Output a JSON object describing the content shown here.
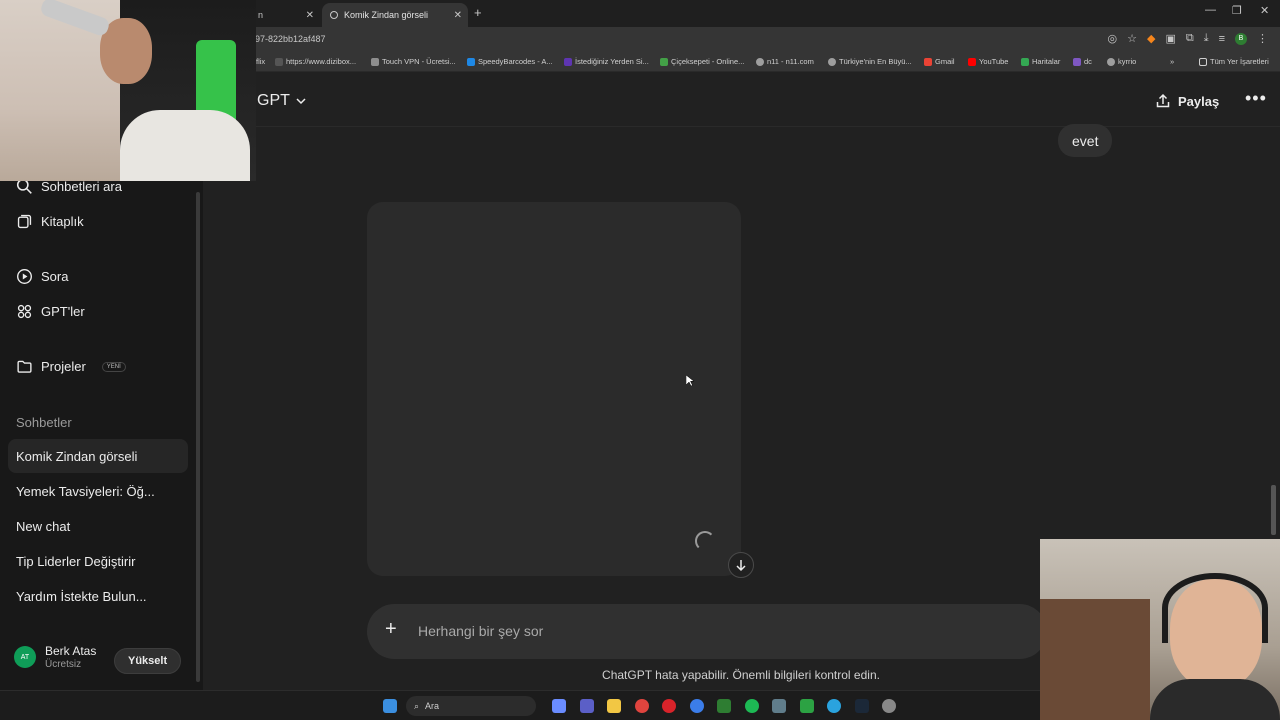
{
  "browser": {
    "tabs": [
      {
        "label": "n",
        "active": false
      },
      {
        "label": "Komik Zindan görseli",
        "active": true
      }
    ],
    "url": "97-822bb12af487",
    "bookmarks": [
      {
        "label": "flix",
        "color": "#c62828"
      },
      {
        "label": "https://www.dizibox...",
        "color": "#555555"
      },
      {
        "label": "Touch VPN - Ücretsi...",
        "color": "#8e8e8e"
      },
      {
        "label": "SpeedyBarcodes - A...",
        "color": "#1e88e5"
      },
      {
        "label": "İstediğiniz Yerden Si...",
        "color": "#5e35b1"
      },
      {
        "label": "Çiçeksepeti - Online...",
        "color": "#43a047"
      },
      {
        "label": "n11 - n11.com",
        "color": "#9e9e9e"
      },
      {
        "label": "Türkiye'nin En Büyü...",
        "color": "#9e9e9e"
      },
      {
        "label": "Gmail",
        "color": "#ea4335"
      },
      {
        "label": "YouTube",
        "color": "#ff0000"
      },
      {
        "label": "Haritalar",
        "color": "#34a853"
      },
      {
        "label": "dc",
        "color": "#7e57c2"
      },
      {
        "label": "kyrrio",
        "color": "#9e9e9e"
      }
    ],
    "all_bookmarks": "Tüm Yer İşaretleri"
  },
  "sidebar": {
    "items": [
      {
        "label": "Sohbetleri ara",
        "icon": "search-icon"
      },
      {
        "label": "Kitaplık",
        "icon": "library-icon"
      },
      {
        "label": "Sora",
        "icon": "play-circle-icon"
      },
      {
        "label": "GPT'ler",
        "icon": "grid-icon"
      },
      {
        "label": "Projeler",
        "icon": "folder-icon",
        "badge": "YENİ"
      }
    ],
    "section_title": "Sohbetler",
    "chats": [
      {
        "label": "Komik Zindan görseli",
        "active": true
      },
      {
        "label": "Yemek Tavsiyeleri: Öğ..."
      },
      {
        "label": "New chat"
      },
      {
        "label": "Tip Liderler Değiştirir"
      },
      {
        "label": "Yardım İstekte Bulun..."
      }
    ],
    "user": {
      "initials": "AT",
      "name": "Berk Atas",
      "plan": "Ücretsiz",
      "upgrade": "Yükselt"
    }
  },
  "main": {
    "model_name": "GPT",
    "share_label": "Paylaş",
    "user_message": "evet",
    "composer_placeholder": "Herhangi bir şey sor",
    "disclaimer": "ChatGPT hata yapabilir. Önemli bilgileri kontrol edin."
  },
  "taskbar": {
    "search_label": "Ara"
  },
  "colors": {
    "background": "#212121",
    "sidebar": "#181818",
    "accent_avatar": "#0f9d58"
  }
}
